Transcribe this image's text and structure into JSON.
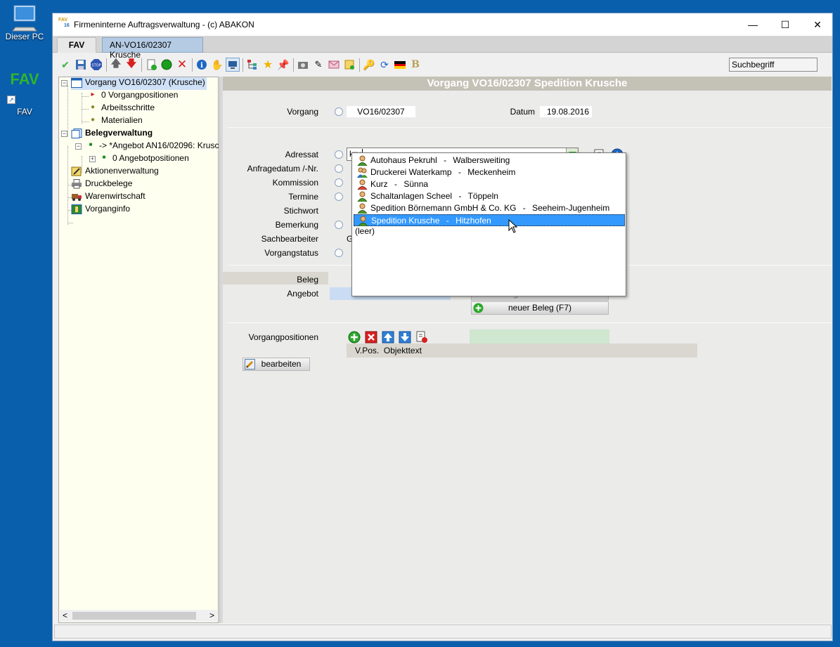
{
  "desktop": {
    "icons": [
      {
        "label": "Dieser PC"
      },
      {
        "label": "FAV",
        "logo": "FAV"
      }
    ]
  },
  "window": {
    "title": "Firmeninterne Auftragsverwaltung - (c) ABAKON",
    "app_icon_text_top": "FAV",
    "app_icon_text_bottom": "16",
    "minimize": "—",
    "maximize": "☐",
    "close": "✕"
  },
  "tabs": [
    {
      "label": "FAV"
    },
    {
      "label": "AN-VO16/02307  Krusche"
    }
  ],
  "toolbar": {
    "search_placeholder": "Suchbegriff",
    "bold_label": "B",
    "stop_label": "STOP",
    "info_label": "i"
  },
  "tree": {
    "items": [
      {
        "label": "Vorgang VO16/02307 (Krusche)"
      },
      {
        "label": "0 Vorgangpositionen"
      },
      {
        "label": "Arbeitsschritte"
      },
      {
        "label": "Materialien"
      },
      {
        "label": "Belegverwaltung"
      },
      {
        "label": "-> *Angebot AN16/02096: Krusc"
      },
      {
        "label": "0 Angebotpositionen"
      },
      {
        "label": "Aktionenverwaltung"
      },
      {
        "label": "Druckbelege"
      },
      {
        "label": "Warenwirtschaft"
      },
      {
        "label": "Vorganginfo"
      }
    ],
    "scroll_left": "<",
    "scroll_right": ">"
  },
  "main": {
    "header": "Vorgang VO16/02307 Spedition Krusche",
    "vorgang_label": "Vorgang",
    "vorgang_value": "VO16/02307",
    "datum_label": "Datum",
    "datum_value": "19.08.2016",
    "fields": [
      {
        "label": "Adressat"
      },
      {
        "label": "Anfragedatum /-Nr."
      },
      {
        "label": "Kommission"
      },
      {
        "label": "Termine"
      },
      {
        "label": "Stichwort"
      },
      {
        "label": "Bemerkung"
      },
      {
        "label": "Sachbearbeiter"
      },
      {
        "label": "Vorgangstatus"
      }
    ],
    "adressat_input": "kru",
    "sachbearbeiter_partial": "G",
    "beleg_label": "Beleg",
    "angebot_label": "Angebot",
    "angebot_bearbeiten_partial": "Angebot bearbeiten",
    "neuer_beleg": "neuer Beleg (F7)",
    "vorgangpositionen_label": "Vorgangpositionen",
    "grid_header": "V.Pos.  Objekttext",
    "bearbeiten": "bearbeiten",
    "info_label": "i"
  },
  "dropdown": {
    "items": [
      {
        "name": "Autohaus Pekruhl",
        "sep": "-",
        "place": "Walbersweiting"
      },
      {
        "name": "Druckerei Waterkamp",
        "sep": "-",
        "place": "Meckenheim"
      },
      {
        "name": "Kurz",
        "sep": "-",
        "place": "Sünna"
      },
      {
        "name": "Schaltanlagen Scheel",
        "sep": "-",
        "place": "Töppeln"
      },
      {
        "name": "Spedition Börnemann GmbH & Co. KG",
        "sep": "-",
        "place": "Seeheim-Jugenheim"
      },
      {
        "name": "Spedition Krusche",
        "sep": "-",
        "place": "Hitzhofen"
      }
    ],
    "empty_option": "(leer)",
    "selected_index": 5
  },
  "colors": {
    "desktop": "#0a5fad",
    "header_bar": "#c4c1b6",
    "selection": "#3399ff",
    "tree_bg": "#fffff0"
  }
}
